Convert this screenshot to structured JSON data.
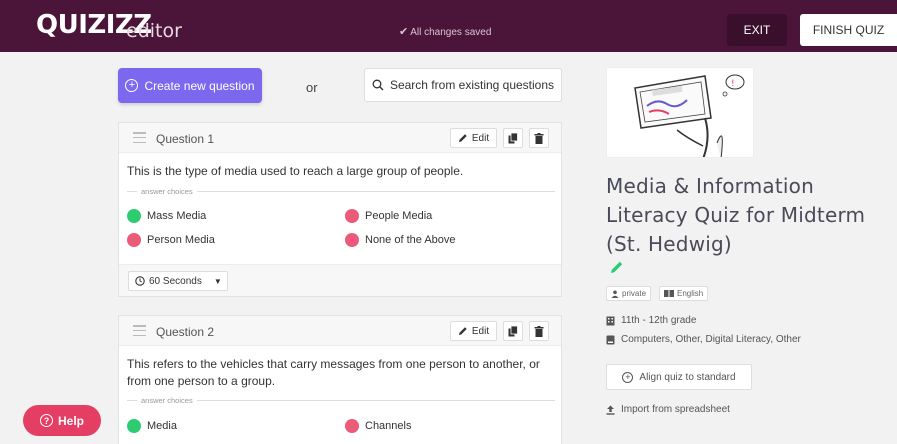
{
  "topbar": {
    "logo": "QUIZIZZ",
    "logo_sub": "editor",
    "saved_status": "All changes saved",
    "exit_label": "EXIT",
    "finish_label": "FINISH QUIZ"
  },
  "actions": {
    "create_label": "Create new question",
    "or_label": "or",
    "search_label": "Search from existing questions"
  },
  "questions": [
    {
      "title": "Question 1",
      "edit_label": "Edit",
      "text": "This is the type of media used to reach a large group of people.",
      "answer_label": "answer choices",
      "choices": [
        {
          "label": "Mass Media",
          "correct": true
        },
        {
          "label": "People Media",
          "correct": false
        },
        {
          "label": "Person Media",
          "correct": false
        },
        {
          "label": "None of the Above",
          "correct": false
        }
      ],
      "timer": "60 Seconds"
    },
    {
      "title": "Question 2",
      "edit_label": "Edit",
      "text": "This refers to the vehicles that carry messages from one person to another, or from one person to a group.",
      "answer_label": "answer choices",
      "choices": [
        {
          "label": "Media",
          "correct": true
        },
        {
          "label": "Channels",
          "correct": false
        }
      ]
    }
  ],
  "help_label": "Help",
  "quiz": {
    "title": "Media & Information Literacy Quiz for Midterm (St. Hedwig)",
    "visibility": "private",
    "language": "English",
    "grade": "11th - 12th grade",
    "subjects": "Computers, Other, Digital Literacy, Other",
    "align_label": "Align quiz to standard",
    "import_label": "Import from spreadsheet"
  },
  "colors": {
    "topbar": "#4a1538",
    "accent": "#7b68ee",
    "correct": "#2ecc71",
    "incorrect": "#ec5a7a",
    "help": "#e53e64"
  }
}
